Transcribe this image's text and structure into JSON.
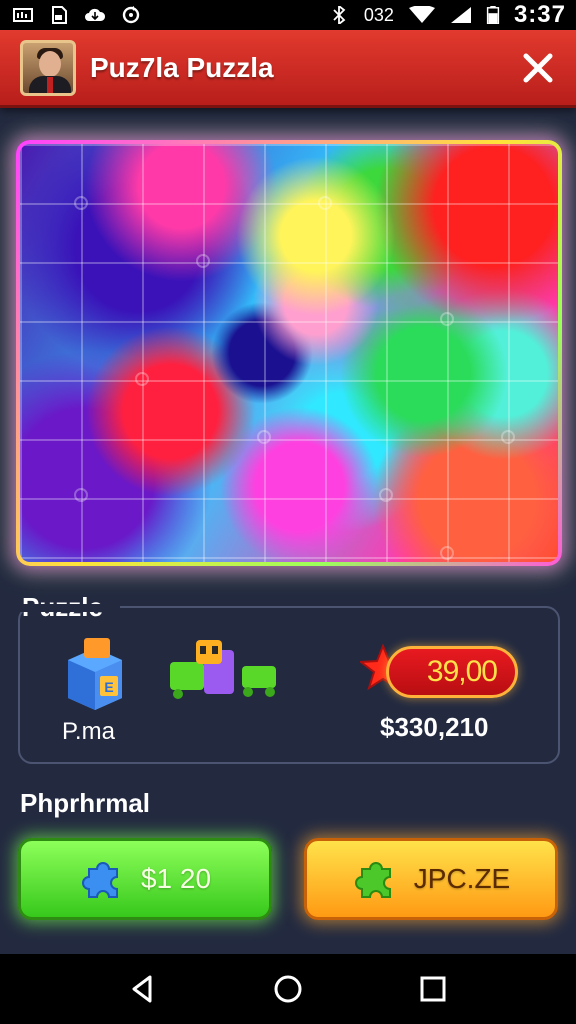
{
  "status_bar": {
    "network_text": "032",
    "time": "3:37",
    "icons": [
      "screen-cast-icon",
      "sim-icon",
      "cloud-icon",
      "sync-icon",
      "bluetooth-icon",
      "wifi-icon",
      "signal-icon",
      "battery-icon"
    ]
  },
  "header": {
    "title": "Puz7la Puzzla",
    "color": "#d22b24",
    "close_icon": "close-icon"
  },
  "puzzle": {
    "title": "Puzzle",
    "item_a_label": "P.ma",
    "price": "39,00",
    "amount": "$330,210"
  },
  "promo": {
    "title": "Phprhrmal",
    "green_button_label": "$1 20",
    "orange_button_label": "JPC.ZE",
    "green_color": "#4cd829",
    "orange_color": "#ffb020"
  },
  "nav": {
    "back": "back-icon",
    "home": "home-icon",
    "recents": "recents-icon"
  }
}
